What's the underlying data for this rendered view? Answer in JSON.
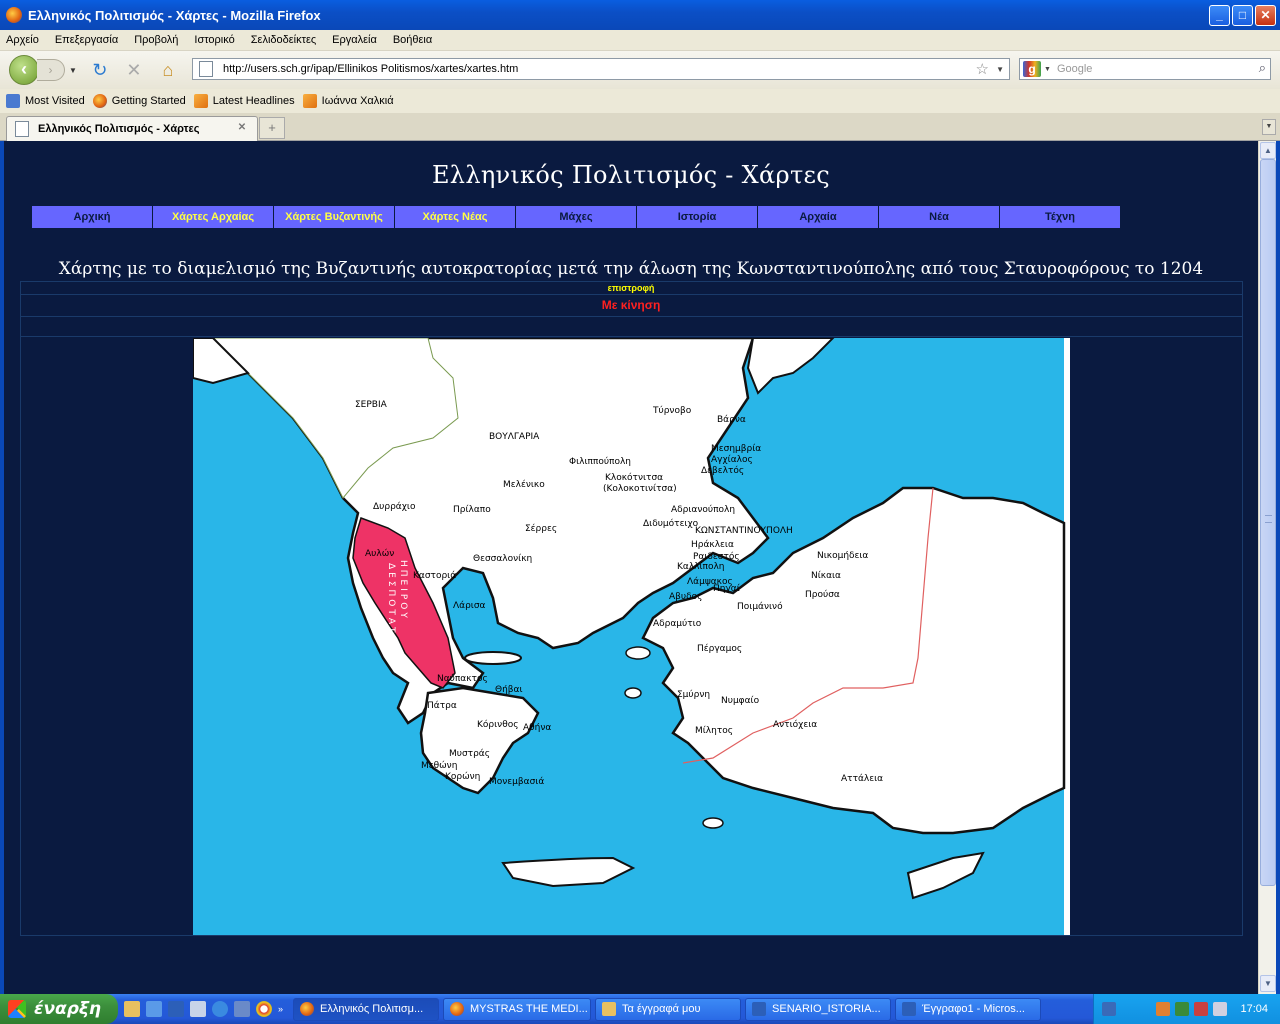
{
  "window": {
    "title": "Ελληνικός Πολιτισμός - Χάρτες - Mozilla Firefox"
  },
  "menu": [
    "Αρχείο",
    "Επεξεργασία",
    "Προβολή",
    "Ιστορικό",
    "Σελιδοδείκτες",
    "Εργαλεία",
    "Βοήθεια"
  ],
  "toolbar": {
    "url": "http://users.sch.gr/ipap/Ellinikos Politismos/xartes/xartes.htm",
    "search_placeholder": "Google"
  },
  "bookmarks": [
    {
      "label": "Most Visited",
      "icon": "most-visited-icon"
    },
    {
      "label": "Getting Started",
      "icon": "firefox-icon"
    },
    {
      "label": "Latest Headlines",
      "icon": "rss-icon"
    },
    {
      "label": "Ιωάννα Χαλκιά",
      "icon": "rss-icon"
    }
  ],
  "tab": {
    "label": "Ελληνικός Πολιτισμός - Χάρτες"
  },
  "page": {
    "title": "Ελληνικός Πολιτισμός - Χάρτες",
    "nav": [
      {
        "label": "Αρχική",
        "highlight": false
      },
      {
        "label": "Χάρτες Αρχαίας",
        "highlight": true
      },
      {
        "label": "Χάρτες Βυζαντινής",
        "highlight": true
      },
      {
        "label": "Χάρτες Νέας",
        "highlight": true
      },
      {
        "label": "Μάχες",
        "highlight": false
      },
      {
        "label": "Ιστορία",
        "highlight": false
      },
      {
        "label": "Αρχαία",
        "highlight": false
      },
      {
        "label": "Νέα",
        "highlight": false
      },
      {
        "label": "Τέχνη",
        "highlight": false
      }
    ],
    "map_heading": "Χάρτης με το διαμελισμό της Βυζαντινής αυτοκρατορίας μετά την άλωση της Κωνσταντινούπολης από τους Σταυροφόρους το 1204",
    "back_link": "επιστροφή",
    "motion_link": "Με κίνηση",
    "map": {
      "sea_color": "#29b6e8",
      "highlight_color": "#ee3366",
      "labels": {
        "serbia": "ΣΕΡΒΙΑ",
        "bulgaria": "ΒΟΥΛΓΑΡΙΑ",
        "tyrnovo": "Τύρνοβο",
        "varna": "Βάρνα",
        "mesembria": "Μεσημβρία",
        "anchialos": "Αγχίαλος",
        "develtos": "Δεβελτός",
        "philippopolis": "Φιλιππούπολη",
        "klokotnitsa": "Κλοκότνιτσα",
        "kolokotinitsa": "(Κολοκοτινίτσα)",
        "meleniko": "Μελένικο",
        "adrianoupolis": "Αδριανούπολη",
        "dyrrachio": "Δυρράχιο",
        "prilapo": "Πρίλαπο",
        "serres": "Σέρρες",
        "didymoteicho": "Διδυμότειχο",
        "konstantinoupoli": "ΚΩΝΣΤΑΝΤΙΝΟΥΠΟΛΗ",
        "avlon": "Αυλών",
        "herakleia": "Ηράκλεια",
        "raidestos": "Ραιδεστός",
        "nikomideia": "Νικομήδεια",
        "thessaloniki": "Θεσσαλονίκη",
        "kallipoli": "Καλλίπολη",
        "nikaia": "Νίκαια",
        "kastoria": "Καστοριά",
        "lampsakos": "Λάμψακος",
        "pigai": "Πηγαί",
        "avydos": "Αβυδος",
        "prousa": "Προύσα",
        "poimanino": "Ποιμάνινό",
        "larisa": "Λάρισα",
        "adramytio": "Αδραμύτιο",
        "pergamos": "Πέργαμος",
        "despotato": "ΔΕΣΠΟΤΑΤΟ",
        "ipeirou": "ΗΠΕΙΡΟΥ",
        "nafpaktos": "Ναύπακτος",
        "thivai": "Θήβαι",
        "smyrni": "Σμύρνη",
        "nymfaio": "Νυμφαίο",
        "patra": "Πάτρα",
        "korinthos": "Κόρινθος",
        "athina": "Αθήνα",
        "militos": "Μίλητος",
        "antiocheia": "Αντιόχεια",
        "mystras": "Μυστράς",
        "methoni": "Μεθώνη",
        "koroni": "Κορώνη",
        "monemvasia": "Μονεμβασιά",
        "attaleia": "Αττάλεια"
      }
    }
  },
  "taskbar": {
    "start_label": "έναρξη",
    "tasks": [
      {
        "label": "Ελληνικός Πολιτισμ...",
        "active": true
      },
      {
        "label": "MYSTRAS THE MEDI...",
        "active": false
      },
      {
        "label": "Τα έγγραφά μου",
        "active": false
      },
      {
        "label": "SENARIO_ISTORIA...",
        "active": false
      },
      {
        "label": "Έγγραφο1 - Micros...",
        "active": false
      }
    ],
    "clock": "17:04"
  }
}
